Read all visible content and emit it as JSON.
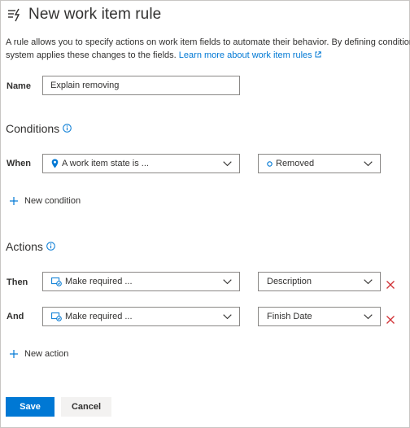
{
  "header": {
    "title": "New work item rule",
    "title_icon": "rule-icon"
  },
  "intro": {
    "line1": "A rule allows you to specify actions on work item fields to automate their behavior. By defining conditions,",
    "line2_prefix": "system applies these changes to the fields. ",
    "learn_more": "Learn more about work item rules"
  },
  "name_field": {
    "label": "Name",
    "value": "Explain removing"
  },
  "conditions": {
    "title": "Conditions",
    "rows": [
      {
        "label": "When",
        "field": "A work item state is ...",
        "field_icon": "location-pin-icon",
        "value": "Removed",
        "value_icon": "circle-outline-icon"
      }
    ],
    "add_label": "New condition"
  },
  "actions": {
    "title": "Actions",
    "rows": [
      {
        "label": "Then",
        "action": "Make required ...",
        "action_icon": "rule-action-icon",
        "field": "Description"
      },
      {
        "label": "And",
        "action": "Make required ...",
        "action_icon": "rule-action-icon",
        "field": "Finish Date"
      }
    ],
    "add_label": "New action"
  },
  "footer": {
    "save_label": "Save",
    "cancel_label": "Cancel"
  },
  "colors": {
    "primary": "#0078d4",
    "delete": "#d13438",
    "border": "#8a8886"
  }
}
